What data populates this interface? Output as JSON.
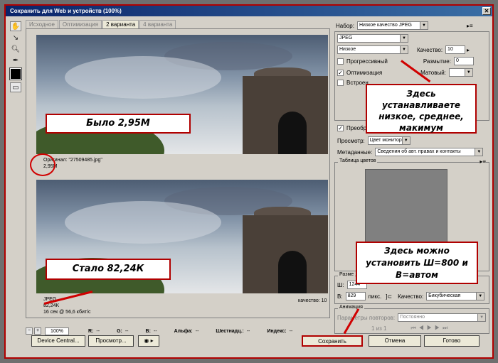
{
  "window": {
    "title": "Сохранить для Web и устройств (100%)",
    "close": "✕"
  },
  "tabs": [
    "Исходное",
    "Оптимизация",
    "2 варианта",
    "4 варианта"
  ],
  "preview_top": {
    "info1": "Оригинал: \"27509485.jpg\"",
    "info2": "2,95M"
  },
  "preview_bottom": {
    "info1": "JPEG",
    "info2": "82,24K",
    "info3": "16 сек @ 56,6 кбит/с",
    "quality": "качество: 10"
  },
  "status": {
    "zoom": "100%",
    "r": "R:",
    "g": "G:",
    "b": "B:",
    "alpha": "Альфа:",
    "hex": "Шестнадц.:",
    "index": "Индекс:",
    "dash": "--"
  },
  "buttons": {
    "device_central": "Device Central...",
    "preview": "Просмотр...",
    "save": "Сохранить",
    "cancel": "Отмена",
    "done": "Готово"
  },
  "panel": {
    "preset_label": "Набор:",
    "preset_value": "Низкое качество JPEG",
    "format": "JPEG",
    "quality_preset": "Низкое",
    "quality_label": "Качество:",
    "quality_value": "10",
    "progressive": "Прогрессивный",
    "blur_label": "Размытие:",
    "blur_value": "0",
    "optimized": "Оптимизация",
    "matte_label": "Матовый:",
    "embed": "Встроен",
    "convert": "Преобра",
    "view_label": "Просмотр:",
    "view_value": "Цвет монитора",
    "metadata_label": "Метаданные:",
    "metadata_value": "Сведения об авт. правах и контакты",
    "color_table": "Таблица цветов",
    "size_title": "Разме",
    "w_label": "Ш:",
    "w_value": "1244",
    "h_label": "В:",
    "h_value": "829",
    "px": "пикс.",
    "quality2_label": "Качество:",
    "quality2_value": "Бикубическая",
    "anim_title": "Анимация",
    "repeat_label": "Параметры повторов:",
    "repeat_value": "Постоянно",
    "frames": "1 из 1"
  },
  "callouts": {
    "before": "Было 2,95М",
    "after": "Стало 82,24К",
    "quality_note": "Здесь устанавливаете низкое, среднее, макимум",
    "size_note": "Здесь можно установить Ш=800 и В=автом"
  }
}
